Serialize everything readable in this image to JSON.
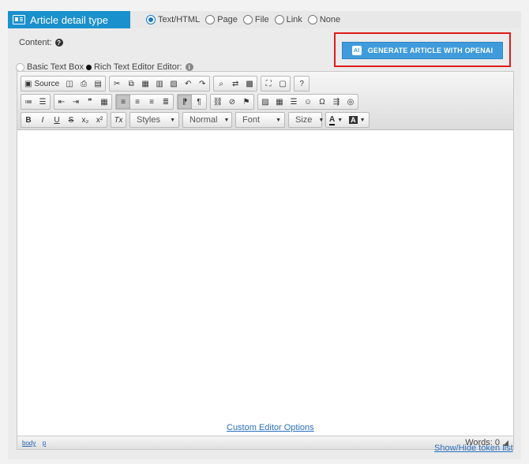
{
  "header": {
    "title": "Article detail type",
    "type_options": [
      {
        "label": "Text/HTML",
        "selected": true
      },
      {
        "label": "Page",
        "selected": false
      },
      {
        "label": "File",
        "selected": false
      },
      {
        "label": "Link",
        "selected": false
      },
      {
        "label": "None",
        "selected": false
      }
    ]
  },
  "content": {
    "label": "Content:",
    "mode_basic": "Basic Text Box",
    "mode_rich": "Rich Text Editor",
    "editor_label": "Editor:",
    "generate_button": "GENERATE ARTICLE WITH OPENAI"
  },
  "toolbar": {
    "source_label": "Source",
    "styles_label": "Styles",
    "format_label": "Normal",
    "font_label": "Font",
    "size_label": "Size",
    "bold": "B",
    "italic": "I",
    "underline": "U",
    "strike": "S",
    "sub": "x₂",
    "sup": "x²",
    "clear": "Tx"
  },
  "statusbar": {
    "path": [
      "body",
      "p"
    ],
    "words": "Words: 0"
  },
  "links": {
    "custom_options": "Custom Editor Options",
    "token_list": "Show/Hide token list"
  },
  "colors": {
    "accent": "#1a90cc",
    "button": "#3f9bdb",
    "highlight_border": "#e01b1b"
  }
}
